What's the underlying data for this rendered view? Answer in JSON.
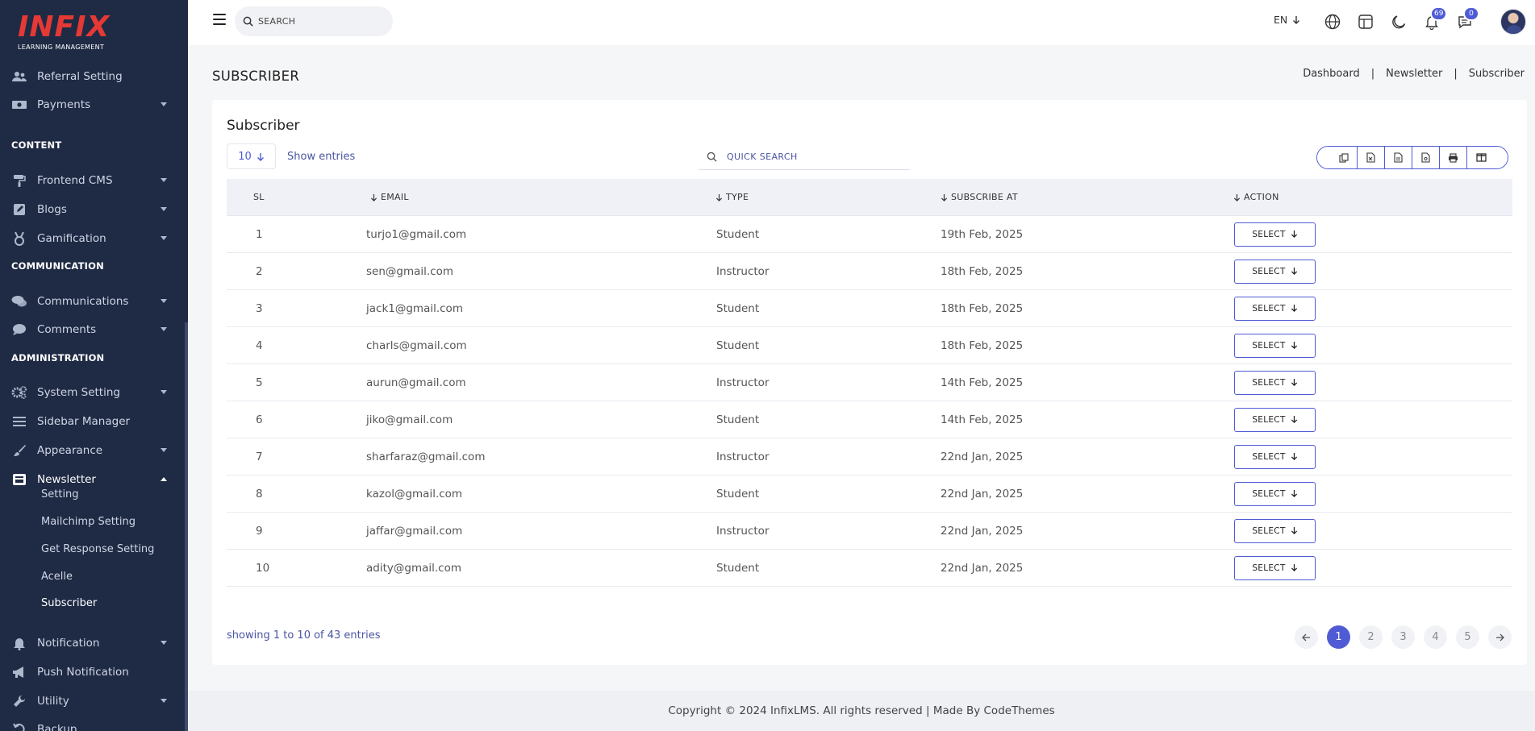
{
  "brand": {
    "logo_text": "INFIX",
    "logo_sub": "LEARNING MANAGEMENT",
    "logo_color": "#e53935"
  },
  "sidebar": {
    "items_top": [
      {
        "label": "Referral Setting",
        "icon": "users-icon",
        "caret": false
      },
      {
        "label": "Payments",
        "icon": "money-icon",
        "caret": true
      }
    ],
    "section_content": "CONTENT",
    "items_content": [
      {
        "label": "Frontend CMS",
        "icon": "paint-roller-icon",
        "caret": true
      },
      {
        "label": "Blogs",
        "icon": "edit-icon",
        "caret": true
      },
      {
        "label": "Gamification",
        "icon": "medal-icon",
        "caret": true
      }
    ],
    "section_communication": "COMMUNICATION",
    "items_communication": [
      {
        "label": "Communications",
        "icon": "chat-icon",
        "caret": true
      },
      {
        "label": "Comments",
        "icon": "comment-icon",
        "caret": true
      }
    ],
    "section_administration": "ADMINISTRATION",
    "items_admin": [
      {
        "label": "System Setting",
        "icon": "gears-icon",
        "caret": true
      },
      {
        "label": "Sidebar Manager",
        "icon": "bars-icon",
        "caret": false
      },
      {
        "label": "Appearance",
        "icon": "brush-icon",
        "caret": true
      },
      {
        "label": "Newsletter",
        "icon": "newsletter-icon",
        "caret": true,
        "expanded": true
      }
    ],
    "newsletter_sub": [
      "Setting",
      "Mailchimp Setting",
      "Get Response Setting",
      "Acelle",
      "Subscriber"
    ],
    "items_bottom": [
      {
        "label": "Notification",
        "icon": "bell-icon",
        "caret": true
      },
      {
        "label": "Push Notification",
        "icon": "megaphone-icon",
        "caret": false
      },
      {
        "label": "Utility",
        "icon": "wrench-icon",
        "caret": true
      },
      {
        "label": "Backup",
        "icon": "undo-icon",
        "caret": false
      }
    ]
  },
  "header": {
    "search_placeholder": "SEARCH",
    "language": "EN",
    "notification_count": "69",
    "message_count": "0"
  },
  "page": {
    "title": "SUBSCRIBER",
    "breadcrumb": [
      "Dashboard",
      "Newsletter",
      "Subscriber"
    ]
  },
  "card": {
    "title": "Subscriber",
    "entries_value": "10",
    "show_entries": "Show entries",
    "quick_search_placeholder": "QUICK SEARCH",
    "columns": [
      "SL",
      "EMAIL",
      "TYPE",
      "SUBSCRIBE AT",
      "ACTION"
    ],
    "rows": [
      {
        "sl": "1",
        "email": "turjo1@gmail.com",
        "type": "Student",
        "date": "19th Feb, 2025"
      },
      {
        "sl": "2",
        "email": "sen@gmail.com",
        "type": "Instructor",
        "date": "18th Feb, 2025"
      },
      {
        "sl": "3",
        "email": "jack1@gmail.com",
        "type": "Student",
        "date": "18th Feb, 2025"
      },
      {
        "sl": "4",
        "email": "charls@gmail.com",
        "type": "Student",
        "date": "18th Feb, 2025"
      },
      {
        "sl": "5",
        "email": "aurun@gmail.com",
        "type": "Instructor",
        "date": "14th Feb, 2025"
      },
      {
        "sl": "6",
        "email": "jiko@gmail.com",
        "type": "Student",
        "date": "14th Feb, 2025"
      },
      {
        "sl": "7",
        "email": "sharfaraz@gmail.com",
        "type": "Instructor",
        "date": "22nd Jan, 2025"
      },
      {
        "sl": "8",
        "email": "kazol@gmail.com",
        "type": "Student",
        "date": "22nd Jan, 2025"
      },
      {
        "sl": "9",
        "email": "jaffar@gmail.com",
        "type": "Instructor",
        "date": "22nd Jan, 2025"
      },
      {
        "sl": "10",
        "email": "adity@gmail.com",
        "type": "Student",
        "date": "22nd Jan, 2025"
      }
    ],
    "select_label": "SELECT",
    "showing": "showing 1 to 10 of 43 entries",
    "pages": [
      "1",
      "2",
      "3",
      "4",
      "5"
    ],
    "active_page": "1"
  },
  "footer": {
    "text": "Copyright © 2024 InfixLMS. All rights reserved | Made By CodeThemes"
  },
  "colors": {
    "sidebar_bg": "#1f2a44",
    "accent": "#4f5bd5"
  }
}
